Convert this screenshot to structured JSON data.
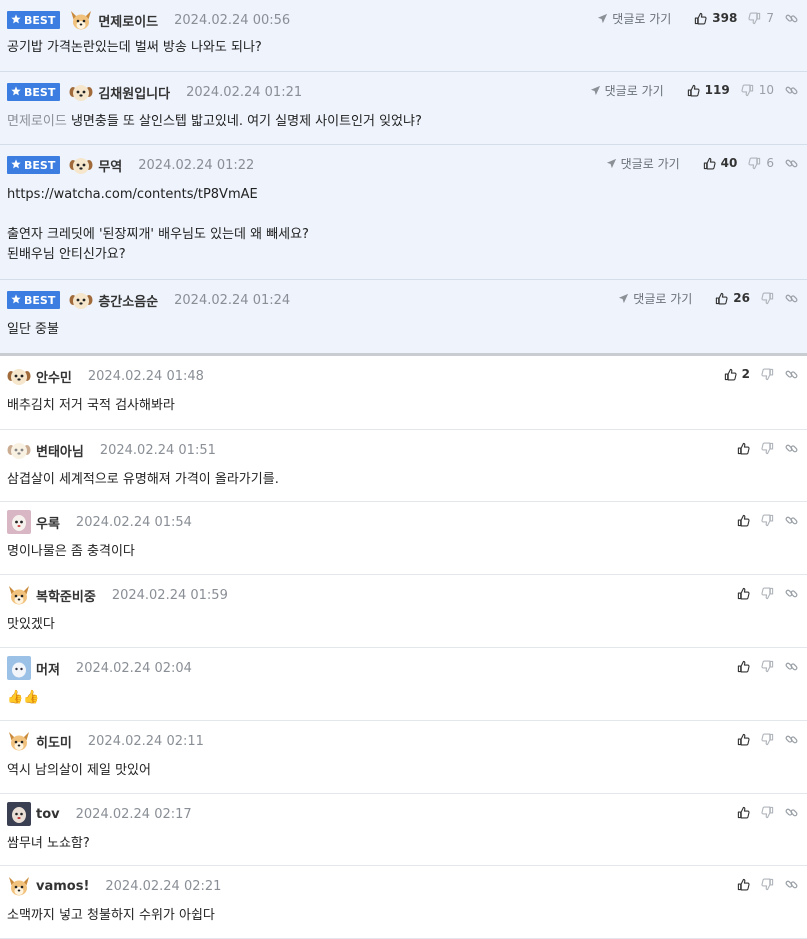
{
  "labels": {
    "best": "BEST",
    "goto": "댓글로 가기"
  },
  "comments": [
    {
      "best": true,
      "avatar": "fox",
      "author": "면제로이드",
      "date": "2024.02.24 00:56",
      "up": "398",
      "down": "7",
      "mention": "",
      "text": "공기밥 가격논란있는데 벌써 방송 나와도 되나?"
    },
    {
      "best": true,
      "avatar": "puppy",
      "author": "김채원입니다",
      "date": "2024.02.24 01:21",
      "up": "119",
      "down": "10",
      "mention": "면제로이드",
      "text": "냉면충들 또 살인스텝 밟고있네. 여기 실명제 사이트인거 잊었냐?"
    },
    {
      "best": true,
      "avatar": "puppy",
      "author": "무역",
      "date": "2024.02.24 01:22",
      "up": "40",
      "down": "6",
      "mention": "",
      "text": "https://watcha.com/contents/tP8VmAE\n\n출연자 크레딧에 '된장찌개' 배우님도 있는데 왜 빼세요?\n된배우님 안티신가요?"
    },
    {
      "best": true,
      "avatar": "puppy",
      "author": "층간소음순",
      "date": "2024.02.24 01:24",
      "up": "26",
      "down": "",
      "mention": "",
      "text": "일단 중불"
    },
    {
      "best": false,
      "avatar": "puppy",
      "author": "안수민",
      "date": "2024.02.24 01:48",
      "up": "2",
      "down": "",
      "mention": "",
      "text": "배추김치 저거 국적 검사해봐라"
    },
    {
      "best": false,
      "avatar": "puppy-faded",
      "author": "변태아님",
      "date": "2024.02.24 01:51",
      "up": "",
      "down": "",
      "mention": "",
      "text": "삼겹살이 세계적으로 유명해져 가격이 올라가기를."
    },
    {
      "best": false,
      "avatar": "photo-pink",
      "author": "우록",
      "date": "2024.02.24 01:54",
      "up": "",
      "down": "",
      "mention": "",
      "text": "명이나물은 좀 충격이다"
    },
    {
      "best": false,
      "avatar": "fox",
      "author": "복학준비중",
      "date": "2024.02.24 01:59",
      "up": "",
      "down": "",
      "mention": "",
      "text": "맛있겠다"
    },
    {
      "best": false,
      "avatar": "photo-blue",
      "author": "머져",
      "date": "2024.02.24 02:04",
      "up": "",
      "down": "",
      "mention": "",
      "text": "👍👍"
    },
    {
      "best": false,
      "avatar": "fox",
      "author": "히도미",
      "date": "2024.02.24 02:11",
      "up": "",
      "down": "",
      "mention": "",
      "text": "역시 남의살이 제일 맛있어"
    },
    {
      "best": false,
      "avatar": "photo-dark",
      "author": "tov",
      "date": "2024.02.24 02:17",
      "up": "",
      "down": "",
      "mention": "",
      "text": "쌈무녀 노쇼함?"
    },
    {
      "best": false,
      "avatar": "fox",
      "author": "vamos!",
      "date": "2024.02.24 02:21",
      "up": "",
      "down": "",
      "mention": "",
      "text": "소맥까지 넣고 청불하지 수위가 아쉽다"
    }
  ],
  "colors": {
    "best_badge": "#3b7de0",
    "best_row_bg": "#eef3fc",
    "date": "#8a8f96",
    "mention": "#8c9198"
  },
  "icons": [
    "star-icon",
    "send-icon",
    "thumb-up-icon",
    "thumb-down-icon",
    "link-icon"
  ]
}
